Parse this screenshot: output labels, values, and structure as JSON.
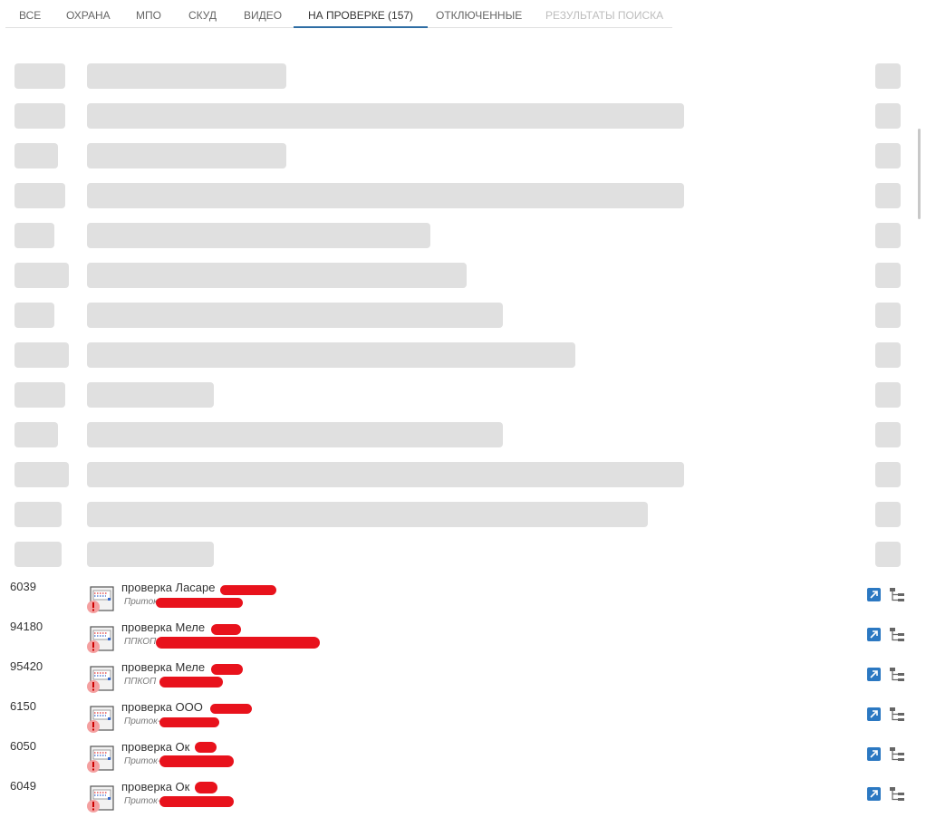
{
  "tabs": [
    {
      "label": "ВСЕ",
      "state": "normal"
    },
    {
      "label": "ОХРАНА",
      "state": "normal"
    },
    {
      "label": "МПО",
      "state": "normal"
    },
    {
      "label": "СКУД",
      "state": "normal"
    },
    {
      "label": "ВИДЕО",
      "state": "normal"
    },
    {
      "label": "НА ПРОВЕРКЕ (157)",
      "state": "active"
    },
    {
      "label": "ОТКЛЮЧЕННЫЕ",
      "state": "normal"
    },
    {
      "label": "РЕЗУЛЬТАТЫ ПОИСКА",
      "state": "disabled"
    }
  ],
  "colors": {
    "accent": "#2e6da4",
    "skeleton": "#e0e0e0",
    "redaction": "#e8121c",
    "open_icon": "#2b78c2",
    "alert": "#f4a0a0"
  },
  "rows": [
    {
      "number": "6039",
      "title": "проверка Ласаре",
      "subtitle": "Приток"
    },
    {
      "number": "94180",
      "title": "проверка Меле",
      "subtitle": "ППКОП"
    },
    {
      "number": "95420",
      "title": "проверка Меле",
      "subtitle": "ППКОП"
    },
    {
      "number": "6150",
      "title": "проверка ООО",
      "subtitle": "Приток-"
    },
    {
      "number": "6050",
      "title": "проверка Ок",
      "subtitle": "Приток-"
    },
    {
      "number": "6049",
      "title": "проверка Ок",
      "subtitle": "Приток-"
    }
  ],
  "row_icons": {
    "device": "device-panel-icon",
    "open": "open-external-icon",
    "tree": "tree-structure-icon"
  }
}
